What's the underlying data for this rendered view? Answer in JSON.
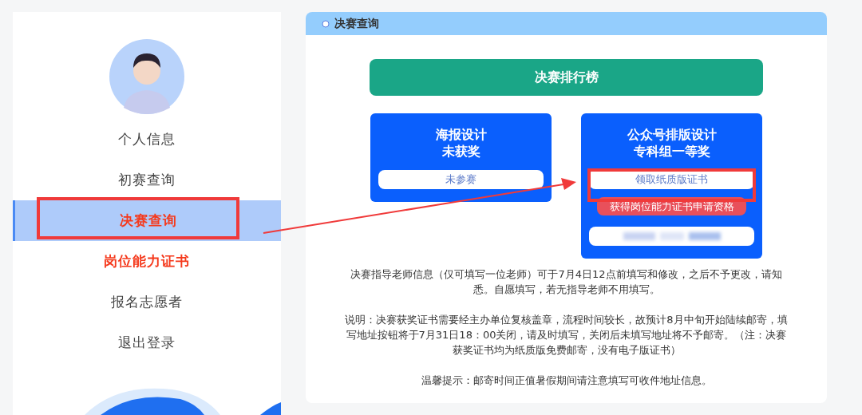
{
  "sidebar": {
    "items": [
      {
        "label": "个人信息",
        "selected": false,
        "emphasized": false
      },
      {
        "label": "初赛查询",
        "selected": false,
        "emphasized": false
      },
      {
        "label": "决赛查询",
        "selected": true,
        "emphasized": true
      },
      {
        "label": "岗位能力证书",
        "selected": false,
        "emphasized": true
      },
      {
        "label": "报名志愿者",
        "selected": false,
        "emphasized": false
      },
      {
        "label": "退出登录",
        "selected": false,
        "emphasized": false
      }
    ]
  },
  "panel": {
    "title": "决赛查询",
    "leaderboard_button": "决赛排行榜",
    "cards": [
      {
        "title": "海报设计",
        "result": "未获奖",
        "button": "未参赛",
        "redacted_button": false
      },
      {
        "title": "公众号排版设计",
        "result": "专科组一等奖",
        "button": "领取纸质版证书",
        "badge": "获得岗位能力证书申请资格",
        "redacted_button": true
      }
    ],
    "notes": [
      "决赛指导老师信息（仅可填写一位老师）可于7月4日12点前填写和修改，之后不予更改，请知悉。自愿填写，若无指导老师不用填写。",
      "说明：决赛获奖证书需要经主办单位复核盖章，流程时间较长，故预计8月中旬开始陆续邮寄，填写地址按钮将于7月31日18：00关闭，请及时填写，关闭后未填写地址将不予邮寄。（注：决赛获奖证书均为纸质版免费邮寄，没有电子版证书）",
      "温馨提示：邮寄时间正值暑假期间请注意填写可收件地址信息。"
    ]
  }
}
